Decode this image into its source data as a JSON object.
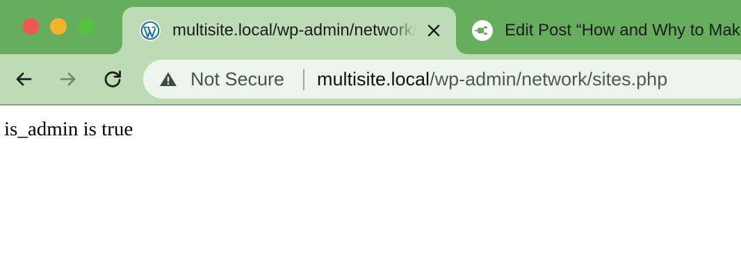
{
  "window": {
    "controls": {
      "close_color": "#ee5a52",
      "minimize_color": "#f4b42a",
      "maximize_color": "#53c23c"
    },
    "theme": {
      "frame_color": "#66ad5e",
      "toolbar_color": "#bddcb6"
    }
  },
  "tabs": [
    {
      "title": "multisite.local/wp-admin/network/sites.php",
      "favicon": "wordpress-icon",
      "active": true
    },
    {
      "title": "Edit Post “How and Why to Make",
      "favicon": "plug-icon",
      "active": false
    }
  ],
  "toolbar": {
    "back_icon": "back-arrow-icon",
    "forward_icon": "forward-arrow-icon",
    "reload_icon": "reload-icon"
  },
  "omnibox": {
    "security_icon": "warning-icon",
    "security_label": "Not Secure",
    "url_host": "multisite.local",
    "url_path": "/wp-admin/network/sites.php"
  },
  "page": {
    "body_text": "is_admin is true"
  }
}
